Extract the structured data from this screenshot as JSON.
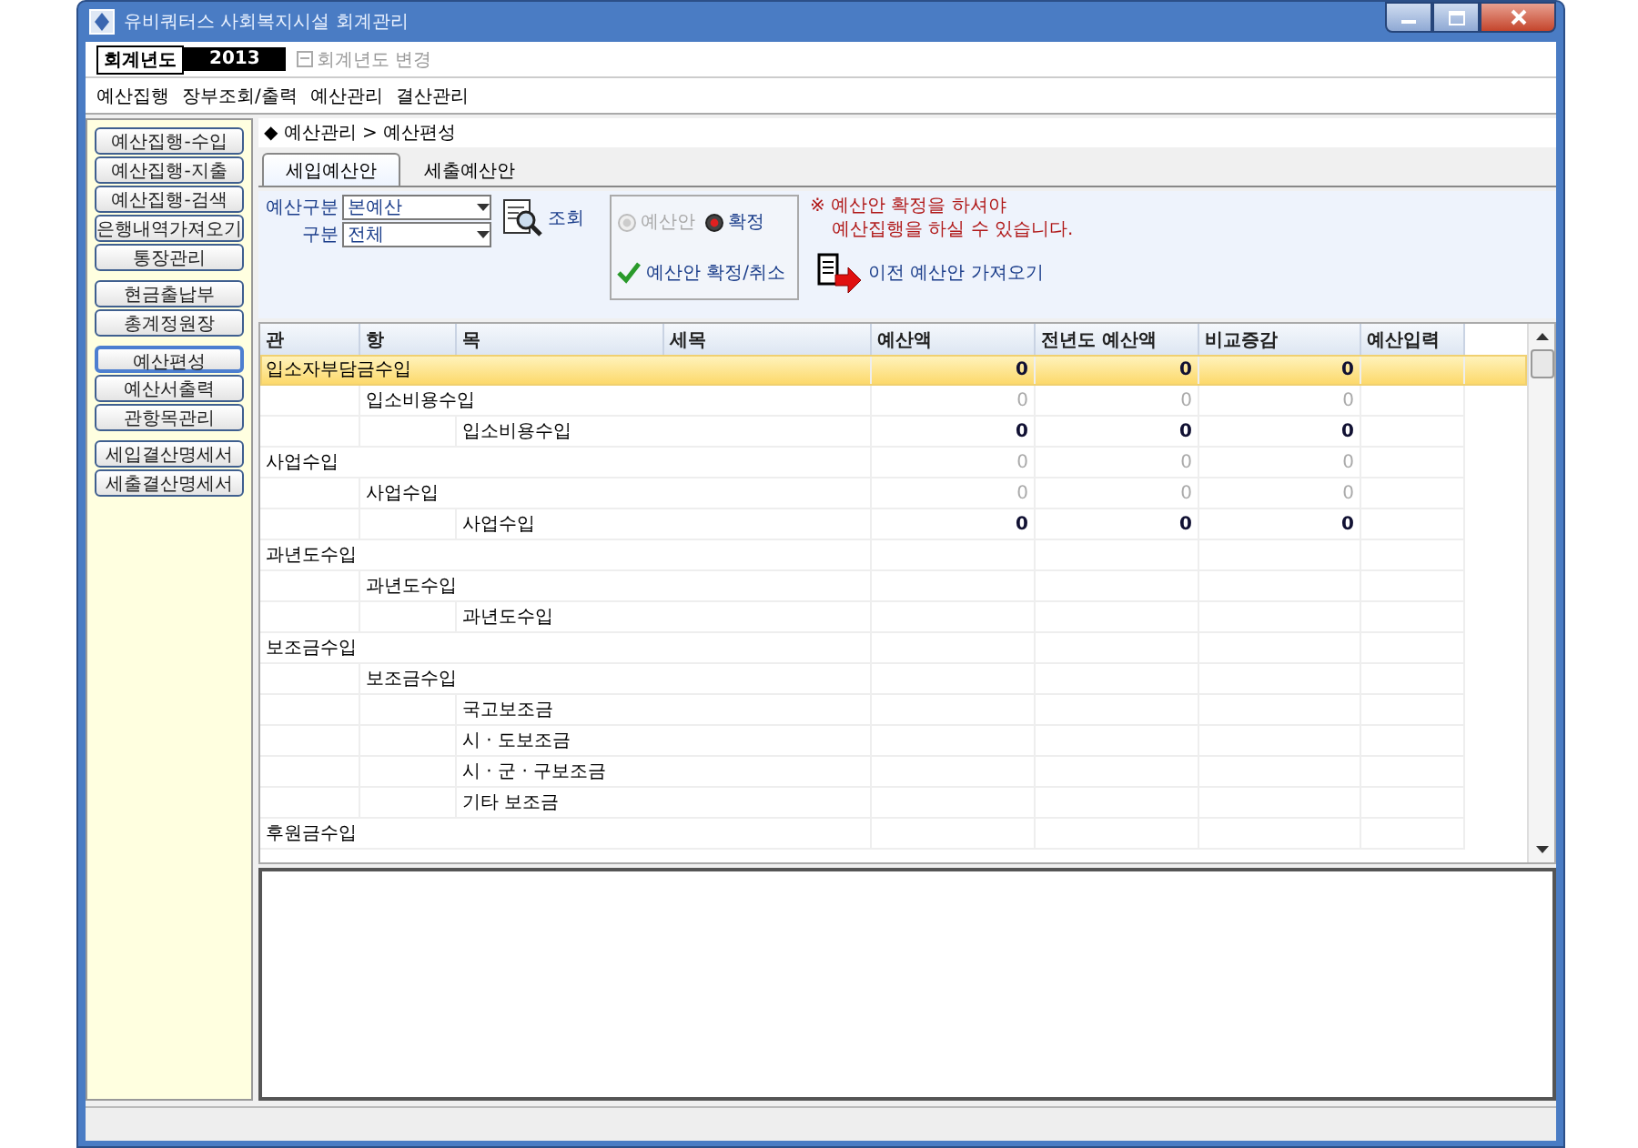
{
  "window": {
    "title": "유비쿼터스 사회복지시설 회계관리"
  },
  "fiscal_year": {
    "label": "회계년도",
    "year": "2013",
    "change_link": "회계년도 변경"
  },
  "menu": [
    "예산집행",
    "장부조회/출력",
    "예산관리",
    "결산관리"
  ],
  "sidebar": {
    "groups": [
      {
        "items": [
          {
            "label": "예산집행-수입",
            "selected": false
          },
          {
            "label": "예산집행-지출",
            "selected": false
          },
          {
            "label": "예산집행-검색",
            "selected": false
          },
          {
            "label": "은행내역가져오기",
            "selected": false
          },
          {
            "label": "통장관리",
            "selected": false
          }
        ]
      },
      {
        "items": [
          {
            "label": "현금출납부",
            "selected": false
          },
          {
            "label": "총계정원장",
            "selected": false
          }
        ]
      },
      {
        "items": [
          {
            "label": "예산편성",
            "selected": true
          },
          {
            "label": "예산서출력",
            "selected": false
          },
          {
            "label": "관항목관리",
            "selected": false
          }
        ]
      },
      {
        "items": [
          {
            "label": "세입결산명세서",
            "selected": false
          },
          {
            "label": "세출결산명세서",
            "selected": false
          }
        ]
      }
    ]
  },
  "breadcrumb": "◆ 예산관리 > 예산편성",
  "tabs": [
    {
      "label": "세입예산안",
      "selected": true
    },
    {
      "label": "세출예산안",
      "selected": false
    }
  ],
  "filters": [
    {
      "label": "예산구분",
      "value": "본예산"
    },
    {
      "label": "구분",
      "value": "전체"
    }
  ],
  "search_button": "조회",
  "status_radios": [
    {
      "label": "예산안",
      "selected": false
    },
    {
      "label": "확정",
      "selected": true
    }
  ],
  "confirm_button": "예산안 확정/취소",
  "notice": [
    "※ 예산안 확정을 하셔야",
    "예산집행을 하실 수 있습니다."
  ],
  "import_button": "이전 예산안 가져오기",
  "table": {
    "columns": [
      "관",
      "항",
      "목",
      "세목",
      "예산액",
      "전년도 예산액",
      "비교증감",
      "예산입력"
    ],
    "rows": [
      {
        "kind": "gwan",
        "label": "입소자부담금수입",
        "selected": true,
        "muted": false,
        "values": [
          "0",
          "0",
          "0"
        ]
      },
      {
        "kind": "hang",
        "label": "입소비용수입",
        "selected": false,
        "muted": true,
        "values": [
          "0",
          "0",
          "0"
        ]
      },
      {
        "kind": "mok",
        "label": "입소비용수입",
        "selected": false,
        "muted": false,
        "values": [
          "0",
          "0",
          "0"
        ]
      },
      {
        "kind": "gwan",
        "label": "사업수입",
        "selected": false,
        "muted": true,
        "values": [
          "0",
          "0",
          "0"
        ]
      },
      {
        "kind": "hang",
        "label": "사업수입",
        "selected": false,
        "muted": true,
        "values": [
          "0",
          "0",
          "0"
        ]
      },
      {
        "kind": "mok",
        "label": "사업수입",
        "selected": false,
        "muted": false,
        "values": [
          "0",
          "0",
          "0"
        ]
      },
      {
        "kind": "gwan",
        "label": "과년도수입",
        "selected": false
      },
      {
        "kind": "hang",
        "label": "과년도수입",
        "selected": false
      },
      {
        "kind": "mok",
        "label": "과년도수입",
        "selected": false
      },
      {
        "kind": "gwan",
        "label": "보조금수입",
        "selected": false
      },
      {
        "kind": "hang",
        "label": "보조금수입",
        "selected": false
      },
      {
        "kind": "mok",
        "label": "국고보조금",
        "selected": false
      },
      {
        "kind": "mok",
        "label": "시 · 도보조금",
        "selected": false
      },
      {
        "kind": "mok",
        "label": "시 · 군 · 구보조금",
        "selected": false
      },
      {
        "kind": "mok",
        "label": "기타 보조금",
        "selected": false
      },
      {
        "kind": "gwan",
        "label": "후원금수입",
        "selected": false
      }
    ]
  }
}
